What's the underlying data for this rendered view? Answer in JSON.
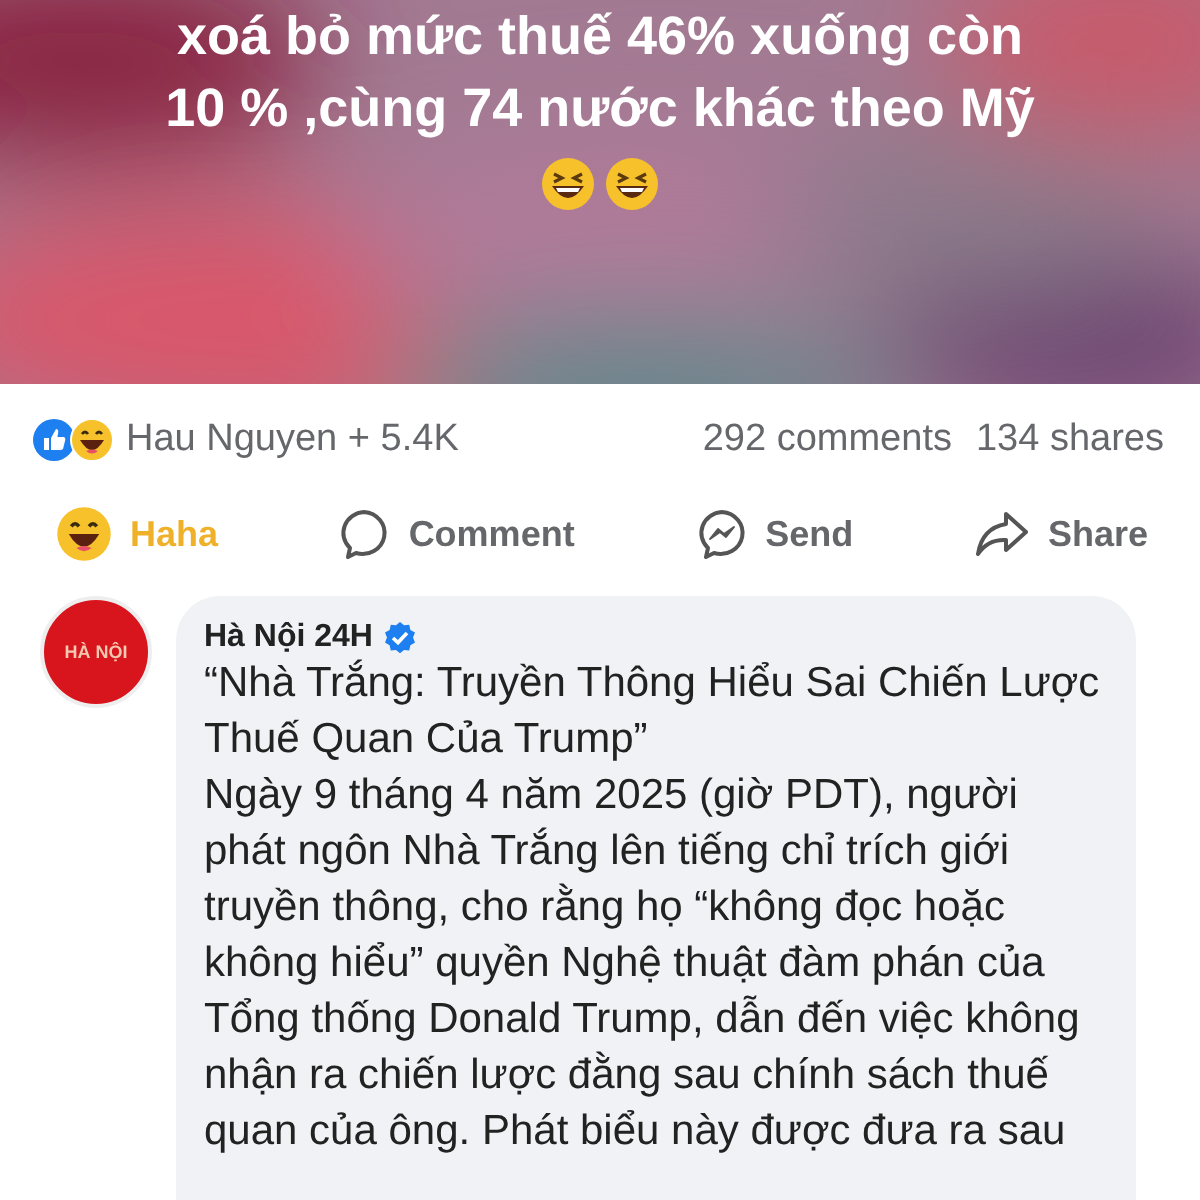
{
  "post": {
    "lines": [
      "xoá bỏ mức thuế 46% xuống còn",
      "10 % ,cùng 74 nước khác theo Mỹ"
    ],
    "emojis": [
      {
        "kind": "laughing"
      },
      {
        "kind": "laughing"
      }
    ]
  },
  "stats": {
    "reactors": "Hau Nguyen + 5.4K",
    "comments": "292 comments",
    "shares": "134 shares"
  },
  "actions": [
    {
      "kind": "reaction",
      "label": "Haha",
      "selected": true
    },
    {
      "kind": "comment",
      "label": "Comment",
      "selected": false
    },
    {
      "kind": "send",
      "label": "Send",
      "selected": false
    },
    {
      "kind": "share",
      "label": "Share",
      "selected": false
    }
  ],
  "comment": {
    "avatar_text": "HÀ NỘI",
    "author": "Hà Nội 24H",
    "verified": true,
    "title": "“Nhà Trắng: Truyền Thông Hiểu Sai Chiến Lược\nThuế Quan Của Trump”",
    "body": "Ngày 9 tháng 4 năm 2025 (giờ PDT), người\nphát ngôn Nhà Trắng lên tiếng chỉ trích giới\ntruyền thông, cho rằng họ “không đọc hoặc\nkhông hiểu” quyền Nghệ thuật đàm phán của\nTổng thống Donald Trump, dẫn đến việc không\nnhận ra chiến lược đằng sau chính sách thuế\nquan của ông. Phát biểu này được đưa ra sau"
  }
}
